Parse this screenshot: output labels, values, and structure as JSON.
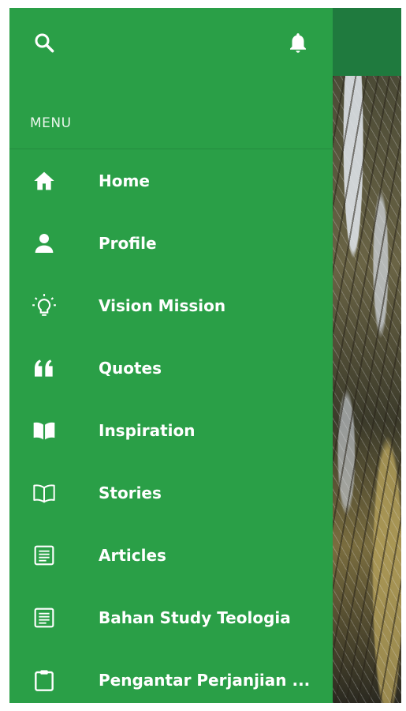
{
  "header": {
    "search_icon": "search-icon",
    "notifications_icon": "bell-icon"
  },
  "menu": {
    "section_label": "MENU",
    "items": [
      {
        "label": "Home",
        "icon": "home-icon"
      },
      {
        "label": "Profile",
        "icon": "person-icon"
      },
      {
        "label": "Vision Mission",
        "icon": "lightbulb-icon"
      },
      {
        "label": "Quotes",
        "icon": "quote-icon"
      },
      {
        "label": "Inspiration",
        "icon": "open-book-filled-icon"
      },
      {
        "label": "Stories",
        "icon": "open-book-outline-icon"
      },
      {
        "label": "Articles",
        "icon": "article-icon"
      },
      {
        "label": "Bahan Study Teologia",
        "icon": "article-icon"
      },
      {
        "label": "Pengantar Perjanjian ...",
        "icon": "clipboard-icon"
      }
    ]
  },
  "colors": {
    "drawer_background": "#2a9f47",
    "app_bar": "#1f7a3e",
    "text": "#ffffff"
  }
}
